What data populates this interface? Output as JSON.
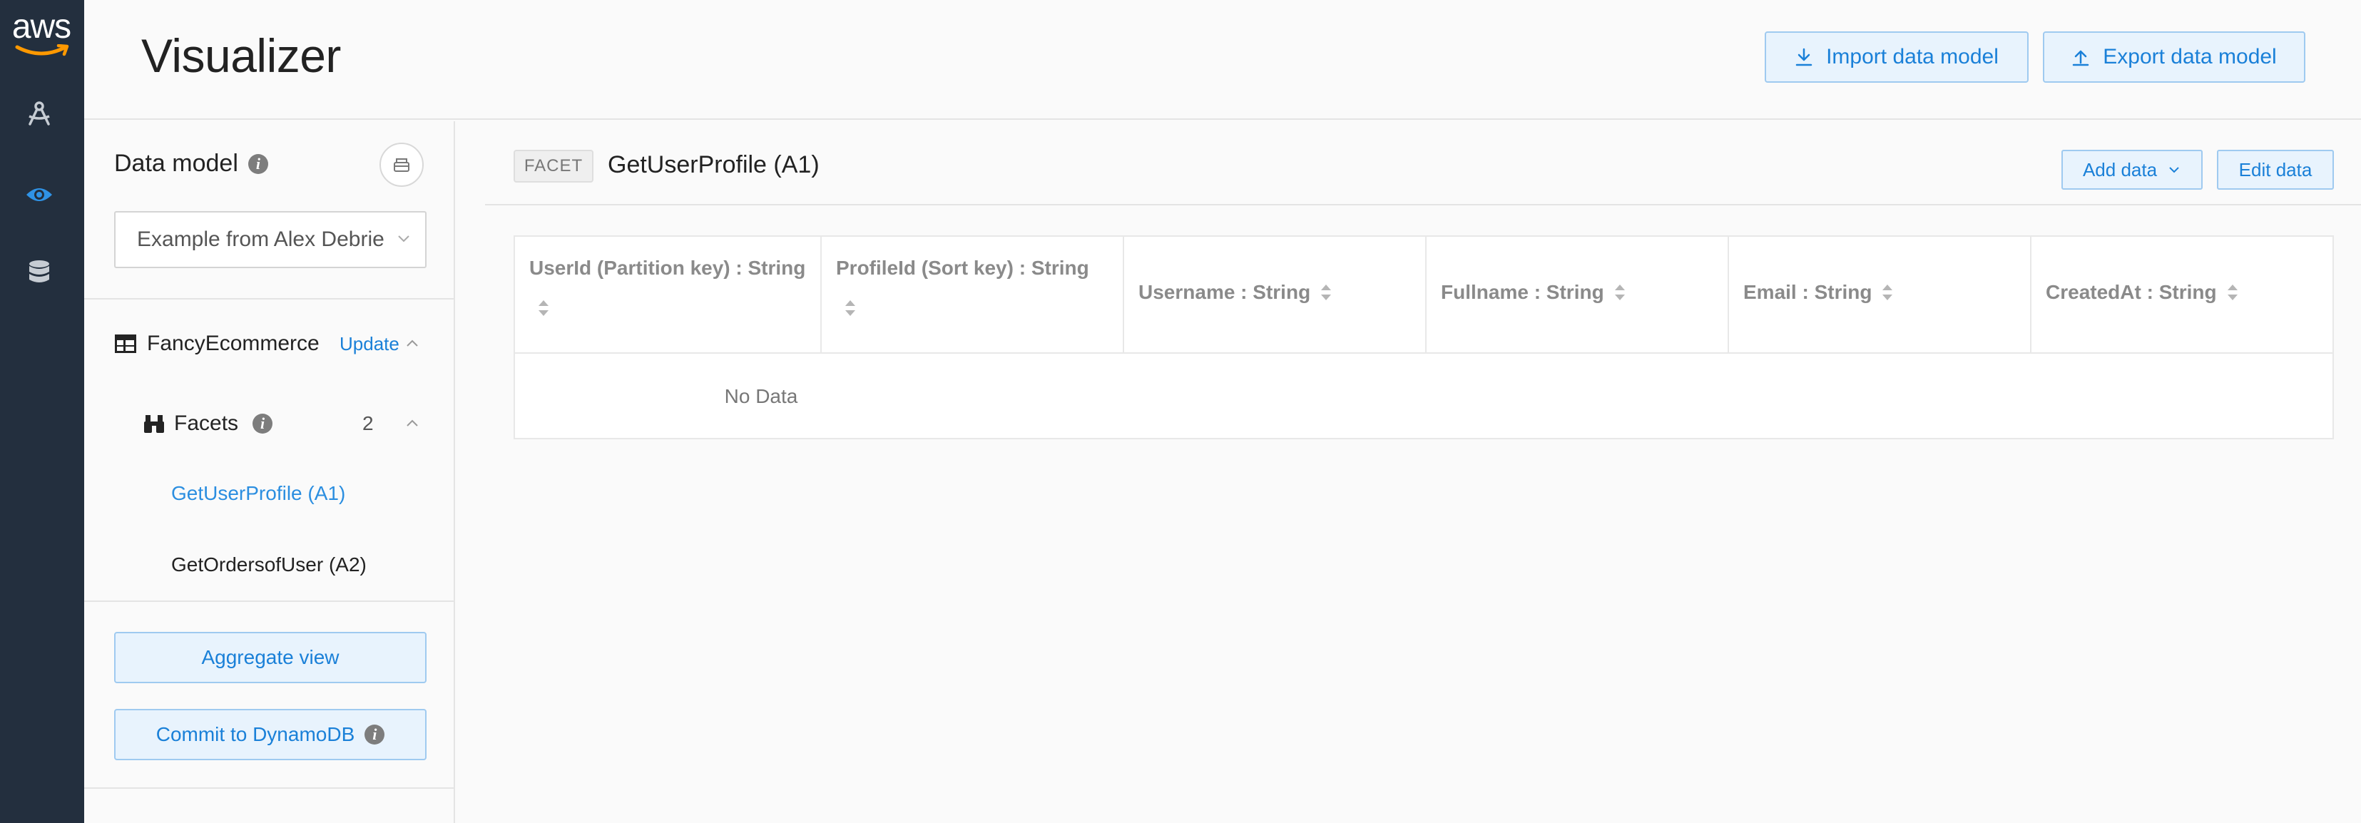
{
  "brand": {
    "logo_text": "aws"
  },
  "rail": {
    "items": [
      {
        "icon": "compass-icon",
        "active": false
      },
      {
        "icon": "eye-icon",
        "active": true
      },
      {
        "icon": "database-icon",
        "active": false
      }
    ]
  },
  "header": {
    "title": "Visualizer",
    "import_label": "Import data model",
    "export_label": "Export data model"
  },
  "sidebar": {
    "data_model_label": "Data model",
    "data_model_selected": "Example from Alex Debrie (r",
    "table_name": "FancyEcommerce",
    "update_label": "Update",
    "facets_label": "Facets",
    "facets_count": "2",
    "facets": [
      {
        "label": "GetUserProfile (A1)",
        "active": true
      },
      {
        "label": "GetOrdersofUser (A2)",
        "active": false
      }
    ],
    "aggregate_label": "Aggregate view",
    "commit_label": "Commit to DynamoDB"
  },
  "main": {
    "facet_tag": "FACET",
    "facet_title": "GetUserProfile (A1)",
    "add_data_label": "Add data",
    "edit_data_label": "Edit data",
    "columns": [
      "UserId (Partition key) : String",
      "ProfileId (Sort key) : String",
      "Username : String",
      "Fullname : String",
      "Email : String",
      "CreatedAt : String"
    ],
    "empty_text": "No Data"
  },
  "colors": {
    "rail_bg": "#232f3e",
    "accent": "#1a80d8",
    "button_bg": "#e8f3fd"
  }
}
